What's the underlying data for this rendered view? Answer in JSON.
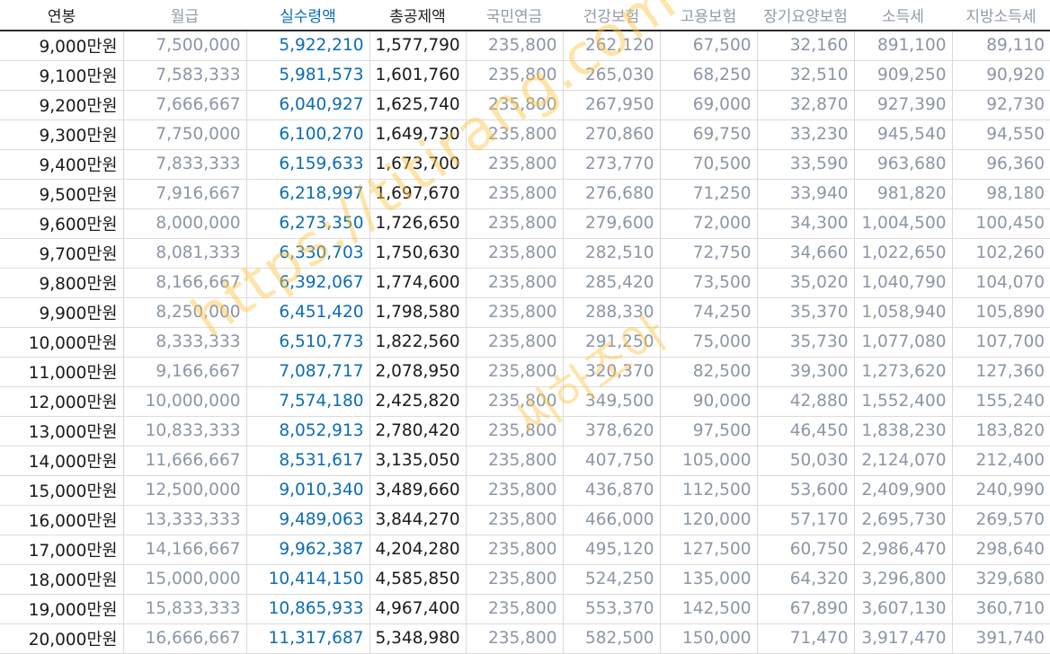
{
  "columns": [
    "연봉",
    "월급",
    "실수령액",
    "총공제액",
    "국민연금",
    "건강보험",
    "고용보험",
    "장기요양보험",
    "소득세",
    "지방소득세"
  ],
  "rows": [
    [
      "9,000만원",
      "7,500,000",
      "5,922,210",
      "1,577,790",
      "235,800",
      "262,120",
      "67,500",
      "32,160",
      "891,100",
      "89,110"
    ],
    [
      "9,100만원",
      "7,583,333",
      "5,981,573",
      "1,601,760",
      "235,800",
      "265,030",
      "68,250",
      "32,510",
      "909,250",
      "90,920"
    ],
    [
      "9,200만원",
      "7,666,667",
      "6,040,927",
      "1,625,740",
      "235,800",
      "267,950",
      "69,000",
      "32,870",
      "927,390",
      "92,730"
    ],
    [
      "9,300만원",
      "7,750,000",
      "6,100,270",
      "1,649,730",
      "235,800",
      "270,860",
      "69,750",
      "33,230",
      "945,540",
      "94,550"
    ],
    [
      "9,400만원",
      "7,833,333",
      "6,159,633",
      "1,673,700",
      "235,800",
      "273,770",
      "70,500",
      "33,590",
      "963,680",
      "96,360"
    ],
    [
      "9,500만원",
      "7,916,667",
      "6,218,997",
      "1,697,670",
      "235,800",
      "276,680",
      "71,250",
      "33,940",
      "981,820",
      "98,180"
    ],
    [
      "9,600만원",
      "8,000,000",
      "6,273,350",
      "1,726,650",
      "235,800",
      "279,600",
      "72,000",
      "34,300",
      "1,004,500",
      "100,450"
    ],
    [
      "9,700만원",
      "8,081,333",
      "6,330,703",
      "1,750,630",
      "235,800",
      "282,510",
      "72,750",
      "34,660",
      "1,022,650",
      "102,260"
    ],
    [
      "9,800만원",
      "8,166,667",
      "6,392,067",
      "1,774,600",
      "235,800",
      "285,420",
      "73,500",
      "35,020",
      "1,040,790",
      "104,070"
    ],
    [
      "9,900만원",
      "8,250,000",
      "6,451,420",
      "1,798,580",
      "235,800",
      "288,330",
      "74,250",
      "35,370",
      "1,058,940",
      "105,890"
    ],
    [
      "10,000만원",
      "8,333,333",
      "6,510,773",
      "1,822,560",
      "235,800",
      "291,250",
      "75,000",
      "35,730",
      "1,077,080",
      "107,700"
    ],
    [
      "11,000만원",
      "9,166,667",
      "7,087,717",
      "2,078,950",
      "235,800",
      "320,370",
      "82,500",
      "39,300",
      "1,273,620",
      "127,360"
    ],
    [
      "12,000만원",
      "10,000,000",
      "7,574,180",
      "2,425,820",
      "235,800",
      "349,500",
      "90,000",
      "42,880",
      "1,552,400",
      "155,240"
    ],
    [
      "13,000만원",
      "10,833,333",
      "8,052,913",
      "2,780,420",
      "235,800",
      "378,620",
      "97,500",
      "46,450",
      "1,838,230",
      "183,820"
    ],
    [
      "14,000만원",
      "11,666,667",
      "8,531,617",
      "3,135,050",
      "235,800",
      "407,750",
      "105,000",
      "50,030",
      "2,124,070",
      "212,400"
    ],
    [
      "15,000만원",
      "12,500,000",
      "9,010,340",
      "3,489,660",
      "235,800",
      "436,870",
      "112,500",
      "53,600",
      "2,409,900",
      "240,990"
    ],
    [
      "16,000만원",
      "13,333,333",
      "9,489,063",
      "3,844,270",
      "235,800",
      "466,000",
      "120,000",
      "57,170",
      "2,695,730",
      "269,570"
    ],
    [
      "17,000만원",
      "14,166,667",
      "9,962,387",
      "4,204,280",
      "235,800",
      "495,120",
      "127,500",
      "60,750",
      "2,986,470",
      "298,640"
    ],
    [
      "18,000만원",
      "15,000,000",
      "10,414,150",
      "4,585,850",
      "235,800",
      "524,250",
      "135,000",
      "64,320",
      "3,296,800",
      "329,680"
    ],
    [
      "19,000만원",
      "15,833,333",
      "10,865,933",
      "4,967,400",
      "235,800",
      "553,370",
      "142,500",
      "67,890",
      "3,607,130",
      "360,710"
    ],
    [
      "20,000만원",
      "16,666,667",
      "11,317,687",
      "5,348,980",
      "235,800",
      "582,500",
      "150,000",
      "71,470",
      "3,917,470",
      "391,740"
    ]
  ],
  "watermark": {
    "url": "https://titirang.com",
    "name": "씨하조아"
  },
  "colors": {
    "salary": "#1a1a1a",
    "net_pay": "#0b6cb5",
    "total_deduction": "#1a1a1a",
    "muted": "#8b96a6",
    "watermark": "#ffc442"
  }
}
